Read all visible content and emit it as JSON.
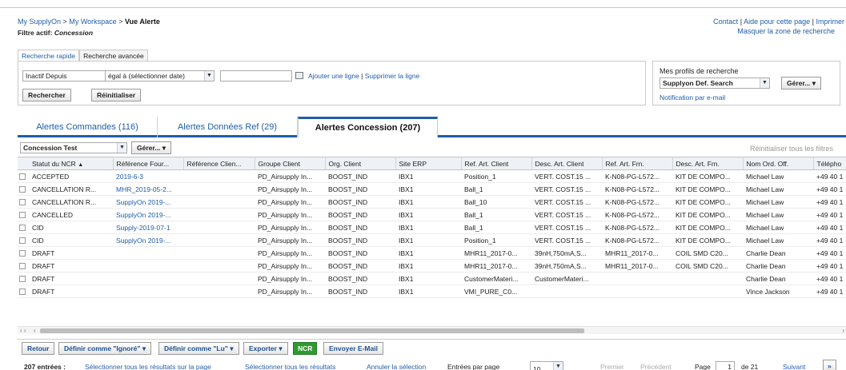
{
  "breadcrumb": {
    "home": "My SupplyOn",
    "workspace": "My Workspace",
    "current": "Vue Alerte",
    "sep": ">"
  },
  "filter_active": {
    "label": "Filtre actif:",
    "value": "Concession"
  },
  "top_links": {
    "contact": "Contact",
    "help": "Aide pour cette page",
    "print": "Imprimer",
    "hide_search": "Masquer la zone de recherche",
    "sep": "|"
  },
  "search_tabs": [
    "Recherche rapide",
    "Recherche avancée"
  ],
  "search": {
    "field": "Inactif Depuis",
    "operator": "égal à (sélectionner date)",
    "add_line": "Ajouter une ligne",
    "remove_line": "Supprimer la ligne",
    "search_button": "Rechercher",
    "reset_button": "Réinitialiser"
  },
  "profiles": {
    "title": "Mes profils de recherche",
    "selected": "Supplyon Def. Search",
    "manage_button": "Gérer...",
    "notification": "Notification par e-mail"
  },
  "main_tabs": [
    {
      "label": "Alertes Commandes (116)"
    },
    {
      "label": "Alertes Données Ref (29)"
    },
    {
      "label": "Alertes Concession (207)"
    }
  ],
  "grid_toolbar": {
    "view": "Concession Test",
    "manage": "Gérer...",
    "reset_filters": "Réinitialiser tous les filtres"
  },
  "columns": [
    "Statut du NCR",
    "Référence Four...",
    "Référence Clien...",
    "Groupe Client",
    "Org. Client",
    "Site ERP",
    "Ref. Art. Client",
    "Desc. Art. Client",
    "Ref. Art. Frn.",
    "Desc. Art. Frn.",
    "Nom Ord. Off.",
    "Télépho"
  ],
  "rows": [
    [
      "ACCEPTED",
      "2019-6-3",
      "",
      "PD_Airsupply In...",
      "BOOST_IND",
      "IBX1",
      "Position_1",
      "VERT. COST.15 ...",
      "K-N08-PG-L572...",
      "KIT DE COMPO...",
      "Michael Law",
      "+49 40 1"
    ],
    [
      "CANCELLATION R...",
      "MHR_2019-05-2...",
      "",
      "PD_Airsupply In...",
      "BOOST_IND",
      "IBX1",
      "Ball_1",
      "VERT. COST.15 ...",
      "K-N08-PG-L572...",
      "KIT DE COMPO...",
      "Michael Law",
      "+49 40 1"
    ],
    [
      "CANCELLATION R...",
      "SupplyOn 2019-...",
      "",
      "PD_Airsupply In...",
      "BOOST_IND",
      "IBX1",
      "Ball_10",
      "VERT. COST.15 ...",
      "K-N08-PG-L572...",
      "KIT DE COMPO...",
      "Michael Law",
      "+49 40 1"
    ],
    [
      "CANCELLED",
      "SupplyOn 2019-...",
      "",
      "PD_Airsupply In...",
      "BOOST_IND",
      "IBX1",
      "Ball_1",
      "VERT. COST.15 ...",
      "K-N08-PG-L572...",
      "KIT DE COMPO...",
      "Michael Law",
      "+49 40 1"
    ],
    [
      "CID",
      "Supply-2019-07-1",
      "",
      "PD_Airsupply In...",
      "BOOST_IND",
      "IBX1",
      "Ball_1",
      "VERT. COST.15 ...",
      "K-N08-PG-L572...",
      "KIT DE COMPO...",
      "Michael Law",
      "+49 40 1"
    ],
    [
      "CID",
      "SupplyOn 2019-...",
      "",
      "PD_Airsupply In...",
      "BOOST_IND",
      "IBX1",
      "Position_1",
      "VERT. COST.15 ...",
      "K-N08-PG-L572...",
      "KIT DE COMPO...",
      "Michael Law",
      "+49 40 1"
    ],
    [
      "DRAFT",
      "",
      "",
      "PD_Airsupply In...",
      "BOOST_IND",
      "IBX1",
      "MHR11_2017-0...",
      "39nH,750mA,S...",
      "MHR11_2017-0...",
      "COIL SMD C20...",
      "Charlie Dean",
      "+49 40 1"
    ],
    [
      "DRAFT",
      "",
      "",
      "PD_Airsupply In...",
      "BOOST_IND",
      "IBX1",
      "MHR11_2017-0...",
      "39nH,750mA,S...",
      "MHR11_2017-0...",
      "COIL SMD C20...",
      "Charlie Dean",
      "+49 40 1"
    ],
    [
      "DRAFT",
      "",
      "",
      "PD_Airsupply In...",
      "BOOST_IND",
      "IBX1",
      "CustomerMateri...",
      "CustomerMateri...",
      "",
      "",
      "Charlie Dean",
      "+49 40 1"
    ],
    [
      "DRAFT",
      "",
      "",
      "PD_Airsupply In...",
      "BOOST_IND",
      "IBX1",
      "VMI_PURE_C0...",
      "",
      "",
      "",
      "Vince Jackson",
      "+49 40 1"
    ]
  ],
  "link_columns": [
    1
  ],
  "actions": {
    "back": "Retour",
    "mark_ignored": "Définir comme \"Ignoré\"",
    "mark_read": "Définir comme \"Lu\"",
    "export": "Exporter",
    "ncr": "NCR",
    "email": "Envoyer E-Mail"
  },
  "footer": {
    "entries": "207 entrées :",
    "select_page": "Sélectionner tous les résultats sur la page",
    "select_all": "Sélectionner tous les résultats",
    "cancel_selection": "Annuler la sélection",
    "per_page_label": "Entrées par page",
    "per_page": "10",
    "first": "Premier",
    "previous": "Précédent",
    "page_label": "Page",
    "page": "1",
    "of": "de 21",
    "next": "Suivant",
    "last": "»"
  },
  "colors": {
    "link": "#1f5ea8",
    "accent": "#1f5ea8",
    "ncr": "#2f9b2f"
  }
}
